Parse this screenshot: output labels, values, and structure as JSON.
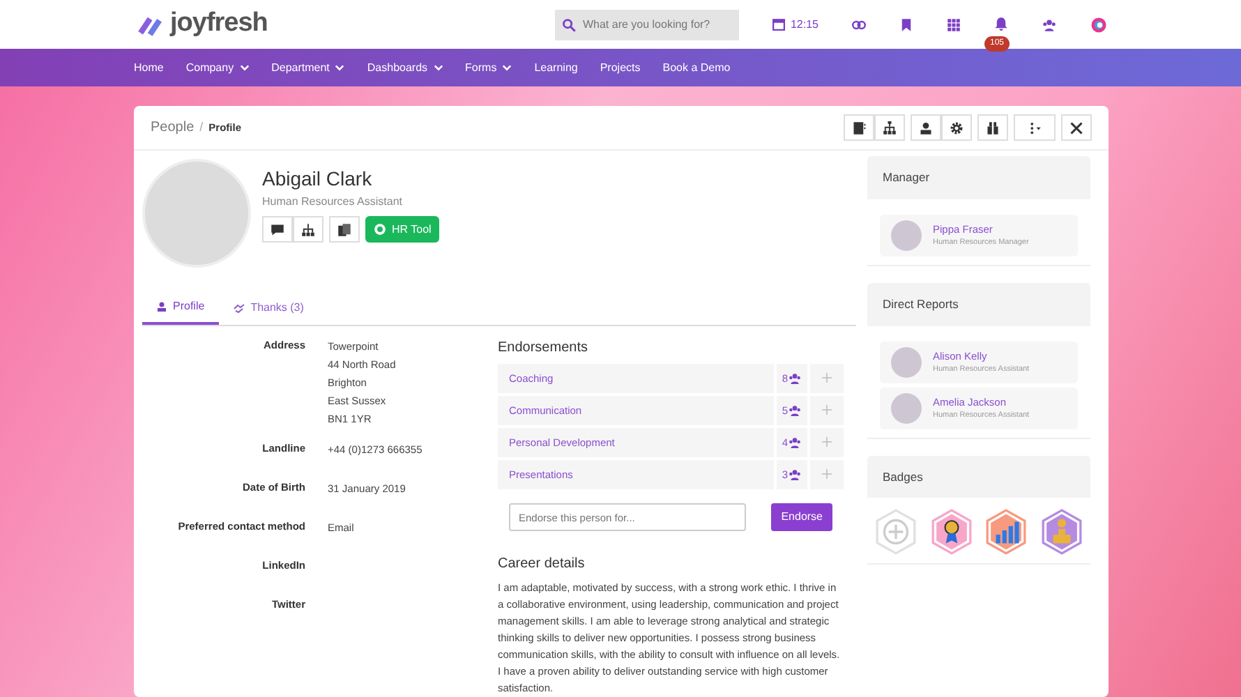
{
  "header": {
    "logo": "joyfresh",
    "search": {
      "placeholder": "What are you looking for?"
    },
    "clock": "12:15",
    "notifications": "105"
  },
  "nav": [
    {
      "label": "Home",
      "dropdown": false
    },
    {
      "label": "Company",
      "dropdown": true
    },
    {
      "label": "Department",
      "dropdown": true
    },
    {
      "label": "Dashboards",
      "dropdown": true
    },
    {
      "label": "Forms",
      "dropdown": true
    },
    {
      "label": "Learning",
      "dropdown": false
    },
    {
      "label": "Projects",
      "dropdown": false
    },
    {
      "label": "Book a Demo",
      "dropdown": false
    }
  ],
  "breadcrumb": [
    "People",
    "Profile"
  ],
  "breadcrumb_separator": "/",
  "profile": {
    "name": "Abigail Clark",
    "role": "Human Resources Assistant",
    "hr_button": "HR Tool"
  },
  "tabs": [
    {
      "label": "Profile",
      "selected": true
    },
    {
      "label": "Thanks (3)",
      "selected": false
    }
  ],
  "details": [
    {
      "label": "Address",
      "lines": [
        "Towerpoint",
        "44 North Road",
        "Brighton",
        "East Sussex",
        "BN1 1YR"
      ]
    },
    {
      "label": "Landline",
      "lines": [
        "+44 (0)1273 666355"
      ]
    },
    {
      "label": "Date of Birth",
      "lines": [
        "31 January 2019"
      ]
    },
    {
      "label": "Preferred contact method",
      "lines": [
        "Email"
      ]
    },
    {
      "label": "LinkedIn"
    },
    {
      "label": "Twitter"
    }
  ],
  "endorsements": {
    "title": "Endorsements",
    "items": [
      {
        "skill": "Coaching",
        "count": "8"
      },
      {
        "skill": "Communication",
        "count": "5"
      },
      {
        "skill": "Personal Development",
        "count": "4"
      },
      {
        "skill": "Presentations",
        "count": "3"
      }
    ],
    "placeholder": "Endorse this person for...",
    "button": "Endorse"
  },
  "career": {
    "title": "Career details",
    "text": "I am adaptable, motivated by success, with a strong work ethic. I thrive in a collaborative environment, using leadership, communication and project management skills. I am able to leverage strong analytical and strategic thinking skills to deliver new opportunities. I possess strong business communication skills, with the ability to consult with influence on all levels. I have a proven ability to deliver outstanding service with high customer satisfaction."
  },
  "manager": {
    "title": "Manager",
    "people": [
      {
        "name": "Pippa Fraser",
        "role": "Human Resources Manager"
      }
    ]
  },
  "reports": {
    "title": "Direct Reports",
    "people": [
      {
        "name": "Alison Kelly",
        "role": "Human Resources Assistant"
      },
      {
        "name": "Amelia Jackson",
        "role": "Human Resources Assistant"
      }
    ]
  },
  "badges": {
    "title": "Badges",
    "items": [
      {
        "kind": "add",
        "color": "#e0e0e0"
      },
      {
        "kind": "rosette",
        "color": "#f7a6c9"
      },
      {
        "kind": "chart",
        "color": "#f79a7f"
      },
      {
        "kind": "podium",
        "color": "#b48be0"
      }
    ]
  }
}
